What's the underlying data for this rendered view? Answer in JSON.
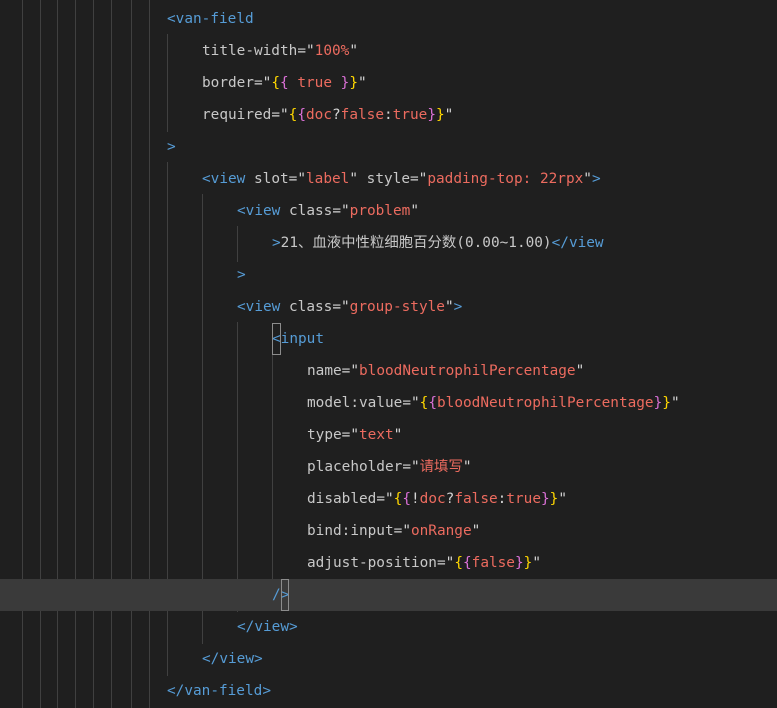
{
  "lines": [
    {
      "indent": 0,
      "text": "<van-field"
    },
    {
      "indent": 1,
      "text": "title-width=\"100%\""
    },
    {
      "indent": 1,
      "text": "border=\"{{ true }}\""
    },
    {
      "indent": 1,
      "text": "required=\"{{doc?false:true}}\""
    },
    {
      "indent": 0,
      "text": ">"
    },
    {
      "indent": 1,
      "text": "<view slot=\"label\" style=\"padding-top: 22rpx\">"
    },
    {
      "indent": 2,
      "text": "<view class=\"problem\""
    },
    {
      "indent": 3,
      "text": ">21、血液中性粒细胞百分数(0.00~1.00)</view"
    },
    {
      "indent": 2,
      "text": ">"
    },
    {
      "indent": 2,
      "text": "<view class=\"group-style\">"
    },
    {
      "indent": 3,
      "text": "<input"
    },
    {
      "indent": 4,
      "text": "name=\"bloodNeutrophilPercentage\""
    },
    {
      "indent": 4,
      "text": "model:value=\"{{bloodNeutrophilPercentage}}\""
    },
    {
      "indent": 4,
      "text": "type=\"text\""
    },
    {
      "indent": 4,
      "text": "placeholder=\"请填写\""
    },
    {
      "indent": 4,
      "text": "disabled=\"{{!doc?false:true}}\""
    },
    {
      "indent": 4,
      "text": "bind:input=\"onRange\""
    },
    {
      "indent": 4,
      "text": "adjust-position=\"{{false}}\""
    },
    {
      "indent": 3,
      "text": "/>"
    },
    {
      "indent": 2,
      "text": "</view>"
    },
    {
      "indent": 1,
      "text": "</view>"
    },
    {
      "indent": 0,
      "text": "</van-field>"
    }
  ],
  "current_line": 18,
  "colors": {
    "background": "#1f1f1f",
    "current_line": "#3a3a3a",
    "indent_guide": "#404040",
    "tag": "#569cd6",
    "attribute": "#c8c8c8",
    "string": "#ec6b5f",
    "bracket_level_1": "#ffd700",
    "bracket_level_2": "#da70d6"
  }
}
